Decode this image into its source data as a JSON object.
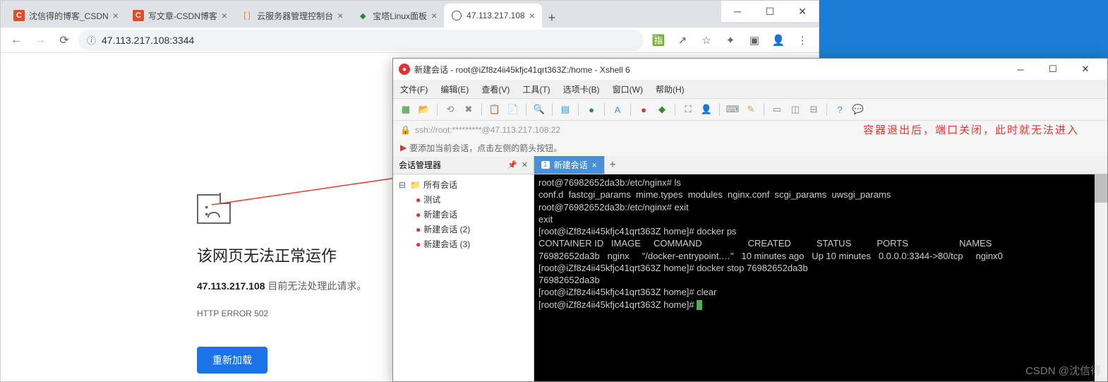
{
  "browser": {
    "tabs": [
      {
        "title": "沈信得的博客_CSDN",
        "fav": "C"
      },
      {
        "title": "写文章-CSDN博客",
        "fav": "C"
      },
      {
        "title": "云服务器管理控制台",
        "fav": "O"
      },
      {
        "title": "宝塔Linux面板",
        "fav": "G"
      },
      {
        "title": "47.113.217.108",
        "fav": "W"
      }
    ],
    "url": "47.113.217.108:3344",
    "error": {
      "heading": "该网页无法正常运作",
      "host": "47.113.217.108",
      "detail": " 目前无法处理此请求。",
      "code": "HTTP ERROR 502",
      "reload": "重新加载"
    }
  },
  "xshell": {
    "title": "新建会话 - root@iZf8z4ii45kfjc41qrt363Z:/home - Xshell 6",
    "menu": [
      "文件(F)",
      "编辑(E)",
      "查看(V)",
      "工具(T)",
      "选项卡(B)",
      "窗口(W)",
      "帮助(H)"
    ],
    "ssh": "ssh://root:*********@47.113.217.108:22",
    "tip": "要添加当前会话，点击左侧的箭头按钮。",
    "annotation": "容器退出后，端口关闭，此时就无法进入",
    "session_header": "会话管理器",
    "tree": {
      "root": "所有会话",
      "items": [
        "测试",
        "新建会话",
        "新建会话 (2)",
        "新建会话 (3)"
      ]
    },
    "term_tab": "新建会话",
    "term_tab_num": "1",
    "terminal_lines": [
      "root@76982652da3b:/etc/nginx# ls",
      "conf.d  fastcgi_params  mime.types  modules  nginx.conf  scgi_params  uwsgi_params",
      "root@76982652da3b:/etc/nginx# exit",
      "exit",
      "[root@iZf8z4ii45kfjc41qrt363Z home]# docker ps",
      "CONTAINER ID   IMAGE     COMMAND                  CREATED          STATUS          PORTS                    NAMES",
      "76982652da3b   nginx     \"/docker-entrypoint.…\"   10 minutes ago   Up 10 minutes   0.0.0.0:3344->80/tcp     nginx0",
      "[root@iZf8z4ii45kfjc41qrt363Z home]# docker stop 76982652da3b",
      "76982652da3b",
      "[root@iZf8z4ii45kfjc41qrt363Z home]# clear",
      "[root@iZf8z4ii45kfjc41qrt363Z home]# "
    ]
  },
  "watermark": "CSDN @沈信得"
}
